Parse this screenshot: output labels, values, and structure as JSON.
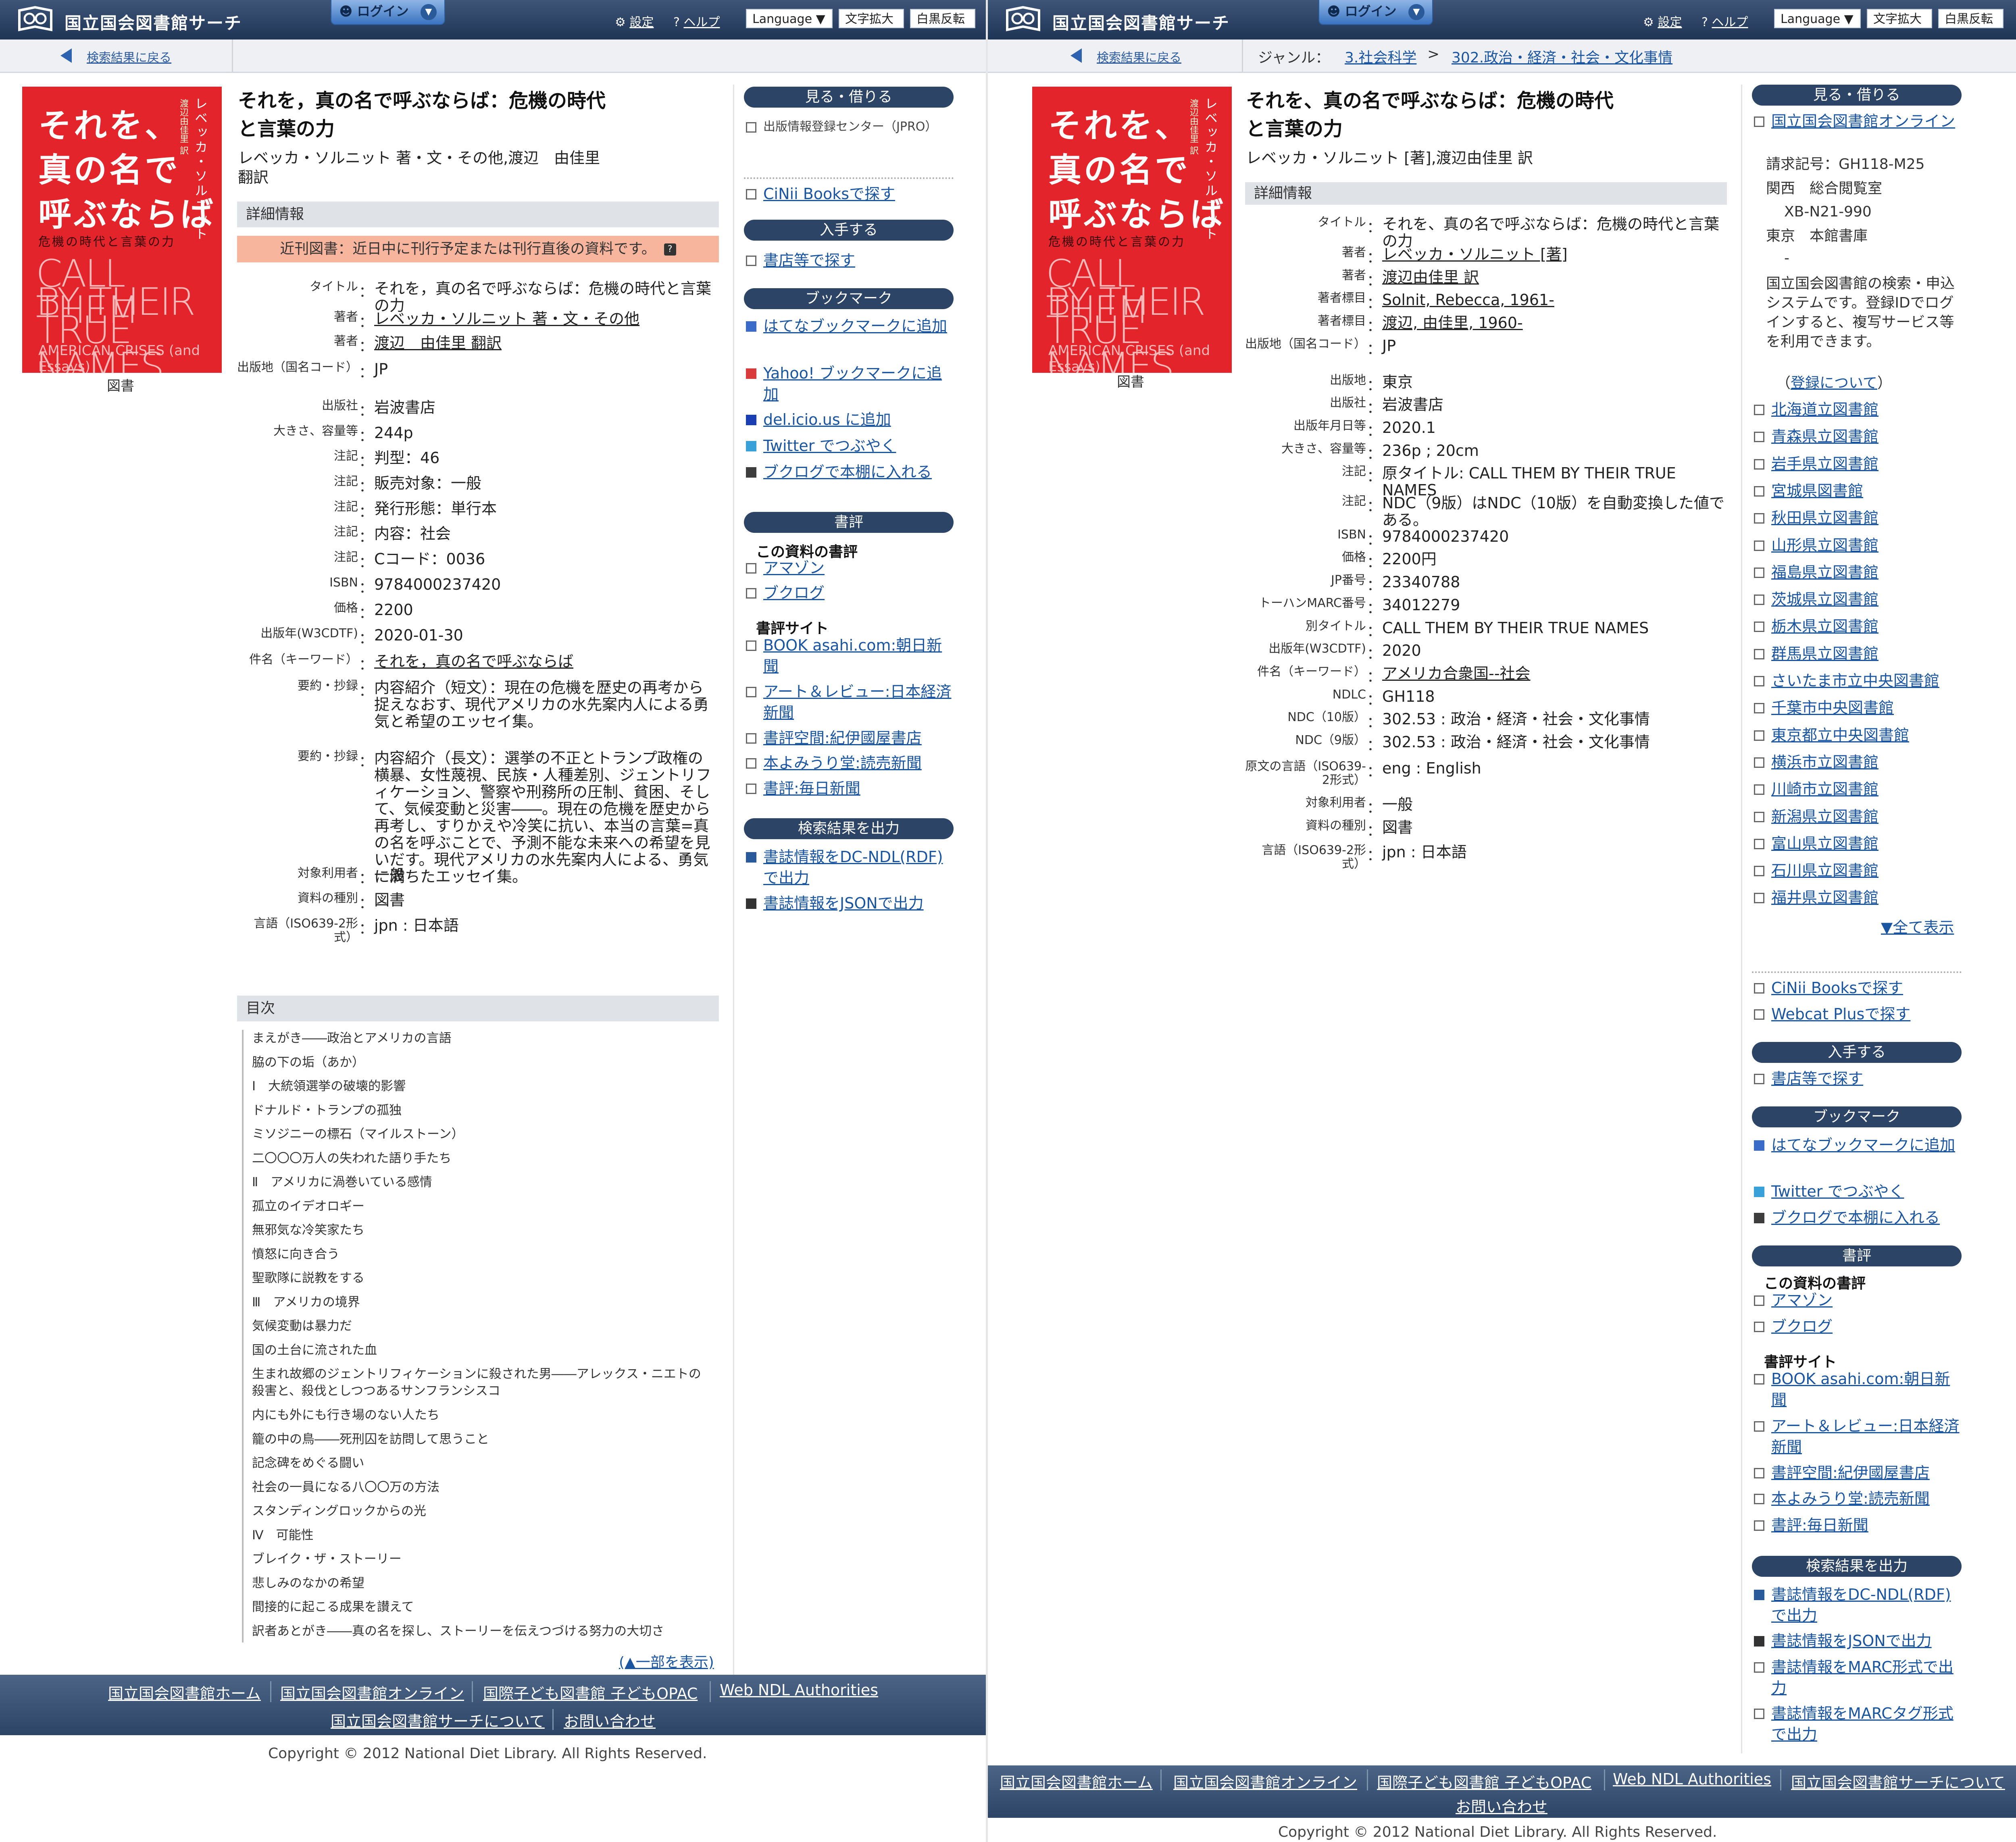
{
  "header": {
    "site_title": "国立国会図書館サーチ",
    "login": "ログイン",
    "settings": "設定",
    "help": "ヘルプ",
    "language": "Language",
    "text_enlarge": "文字拡大",
    "invert": "白黒反転"
  },
  "left": {
    "back": "検索結果に戻る",
    "cover": {
      "jp_line1": "それを、",
      "jp_line2": "真の名で",
      "jp_line3": "呼ぶならば",
      "jp_sub": "危機の時代と言葉の力",
      "author_vertical": "レベッカ・ソルニット",
      "translator_vertical": "渡辺由佳里 訳",
      "en_line1": "CALL THEM",
      "en_line2": "BY THEIR",
      "en_line3": "TRUE NAMES",
      "en_sub": "AMERICAN CRISES (and Essays)",
      "caption": "図書"
    },
    "title_line1": "それを，真の名で呼ぶならば：危機の時代",
    "title_line2": "と言葉の力",
    "author_line1": "レベッカ・ソルニット 著・文・その他,渡辺　由佳里",
    "author_line2": "翻訳",
    "details_heading": "詳細情報",
    "notice": "近刊図書：近日中に刊行予定または刊行直後の資料です。",
    "details": [
      {
        "label": "タイトル",
        "value": "それを，真の名で呼ぶならば：危機の時代と言葉の力"
      },
      {
        "label": "著者",
        "value": "レベッカ・ソルニット 著・文・その他"
      },
      {
        "label": "著者",
        "value": "渡辺　由佳里 翻訳"
      },
      {
        "label": "出版地（国名コード）",
        "value": "JP"
      },
      {
        "label": "出版社",
        "value": "岩波書店"
      },
      {
        "label": "大きさ、容量等",
        "value": "244p"
      },
      {
        "label": "注記",
        "value": "判型：46"
      },
      {
        "label": "注記",
        "value": "販売対象：一般"
      },
      {
        "label": "注記",
        "value": "発行形態：単行本"
      },
      {
        "label": "注記",
        "value": "内容：社会"
      },
      {
        "label": "注記",
        "value": "Cコード：0036"
      },
      {
        "label": "ISBN",
        "value": "9784000237420"
      },
      {
        "label": "価格",
        "value": "2200"
      },
      {
        "label": "出版年(W3CDTF)",
        "value": "2020-01-30"
      },
      {
        "label": "件名（キーワード）",
        "value": "それを，真の名で呼ぶならば"
      },
      {
        "label": "要約・抄録",
        "value": "内容紹介（短文）：現在の危機を歴史の再考から捉えなおす、現代アメリカの水先案内人による勇気と希望のエッセイ集。"
      },
      {
        "label": "要約・抄録",
        "value": "内容紹介（長文）：選挙の不正とトランプ政権の横暴、女性蔑視、民族・人種差別、ジェントリフィケーション、警察や刑務所の圧制、貧困、そして、気候変動と災害――。現在の危機を歴史から再考し、すりかえや冷笑に抗い、本当の言葉=真の名を呼ぶことで、予測不能な未来への希望を見いだす。現代アメリカの水先案内人による、勇気に満ちたエッセイ集。"
      },
      {
        "label": "対象利用者",
        "value": "一般"
      },
      {
        "label": "資料の種別",
        "value": "図書"
      },
      {
        "label": "言語（ISO639-2形式）",
        "value": "jpn : 日本語"
      }
    ],
    "toc_heading": "目次",
    "toc": [
      "まえがき――政治とアメリカの言語",
      "脇の下の垢（あか）",
      "Ⅰ　大統領選挙の破壊的影響",
      "ドナルド・トランプの孤独",
      "ミソジニーの標石（マイルストーン）",
      "二〇〇〇万人の失われた語り手たち",
      "Ⅱ　アメリカに渦巻いている感情",
      "孤立のイデオロギー",
      "無邪気な冷笑家たち",
      "憤怒に向き合う",
      "聖歌隊に説教をする",
      "Ⅲ　アメリカの境界",
      "気候変動は暴力だ",
      "国の土台に流された血",
      "生まれ故郷のジェントリフィケーションに殺された男――アレックス・ニエトの殺害と、殺伐としつつあるサンフランシスコ",
      "内にも外にも行き場のない人たち",
      "籠の中の鳥――死刑囚を訪問して思うこと",
      "記念碑をめぐる闘い",
      "社会の一員になる八〇〇万の方法",
      "スタンディングロックからの光",
      "Ⅳ　可能性",
      "ブレイク・ザ・ストーリー",
      "悲しみのなかの希望",
      "間接的に起こる成果を讃えて",
      "訳者あとがき――真の名を探し、ストーリーを伝えつづける努力の大切さ"
    ],
    "toc_more": "(▲一部を表示)",
    "sidebar": {
      "view": "見る・借りる",
      "view_links": [
        "出版情報登録センター（JPRO）"
      ],
      "cinii": "CiNii Booksで探す",
      "obtain": "入手する",
      "shops": "書店等で探す",
      "bookmark": "ブックマーク",
      "bookmarks": [
        "はてなブックマークに追加",
        "Yahoo! ブックマークに追加",
        "del.icio.us に追加",
        "Twitter でつぶやく",
        "ブクログで本棚に入れる"
      ],
      "review": "書評",
      "review_this": "この資料の書評",
      "review_this_links": [
        "アマゾン",
        "ブクログ"
      ],
      "review_sites": "書評サイト",
      "review_site_links": [
        "BOOK asahi.com:朝日新聞",
        "アート＆レビュー:日本経済新聞",
        "書評空間:紀伊國屋書店",
        "本よみうり堂:読売新聞",
        "書評:毎日新聞"
      ],
      "export": "検索結果を出力",
      "export_links": [
        "書誌情報をDC-NDL(RDF)で出力",
        "書誌情報をJSONで出力"
      ]
    },
    "footer_links": [
      "国立国会図書館ホーム",
      "国立国会図書館オンライン",
      "国際子ども図書館 子どもOPAC",
      "Web NDL Authorities",
      "国立国会図書館サーチについて",
      "お問い合わせ"
    ],
    "copyright": "Copyright © 2012 National Diet Library. All Rights Reserved."
  },
  "right": {
    "back": "検索結果に戻る",
    "genre_label": "ジャンル：",
    "genre1": "3.社会科学",
    "genre_sep": ">",
    "genre2": "302.政治・経済・社会・文化事情",
    "cover_caption": "図書",
    "title_line1": "それを、真の名で呼ぶならば：危機の時代",
    "title_line2": "と言葉の力",
    "author": "レベッカ・ソルニット [著],渡辺由佳里 訳",
    "details_heading": "詳細情報",
    "details": [
      {
        "label": "タイトル",
        "value": "それを、真の名で呼ぶならば：危機の時代と言葉の力"
      },
      {
        "label": "著者",
        "value": "レベッカ・ソルニット [著]"
      },
      {
        "label": "著者",
        "value": "渡辺由佳里 訳"
      },
      {
        "label": "著者標目",
        "value": "Solnit, Rebecca, 1961-"
      },
      {
        "label": "著者標目",
        "value": "渡辺, 由佳里, 1960-"
      },
      {
        "label": "出版地（国名コード）",
        "value": "JP"
      },
      {
        "label": "出版地",
        "value": "東京"
      },
      {
        "label": "出版社",
        "value": "岩波書店"
      },
      {
        "label": "出版年月日等",
        "value": "2020.1"
      },
      {
        "label": "大きさ、容量等",
        "value": "236p ; 20cm"
      },
      {
        "label": "注記",
        "value": "原タイトル: CALL THEM BY THEIR TRUE NAMES"
      },
      {
        "label": "注記",
        "value": "NDC（9版）はNDC（10版）を自動変換した値である。"
      },
      {
        "label": "ISBN",
        "value": "9784000237420"
      },
      {
        "label": "価格",
        "value": "2200円"
      },
      {
        "label": "JP番号",
        "value": "23340788"
      },
      {
        "label": "トーハンMARC番号",
        "value": "34012279"
      },
      {
        "label": "別タイトル",
        "value": "CALL THEM BY THEIR TRUE NAMES"
      },
      {
        "label": "出版年(W3CDTF)",
        "value": "2020"
      },
      {
        "label": "件名（キーワード）",
        "value": "アメリカ合衆国--社会"
      },
      {
        "label": "NDLC",
        "value": "GH118"
      },
      {
        "label": "NDC（10版）",
        "value": "302.53 : 政治・経済・社会・文化事情"
      },
      {
        "label": "NDC（9版）",
        "value": "302.53 : 政治・経済・社会・文化事情"
      },
      {
        "label": "原文の言語（ISO639-2形式）",
        "value": "eng : English"
      },
      {
        "label": "対象利用者",
        "value": "一般"
      },
      {
        "label": "資料の種別",
        "value": "図書"
      },
      {
        "label": "言語（ISO639-2形式）",
        "value": "jpn : 日本語"
      }
    ],
    "sidebar": {
      "view": "見る・借りる",
      "ndl_online": "国立国会図書館オンライン",
      "call_no": "請求記号：GH118-M25",
      "loc1": "関西　総合閲覧室",
      "loc1_code": "XB-N21-990",
      "loc2": "東京　本館書庫",
      "loc2_code": "-",
      "ndl_desc": "国立国会図書館の検索・申込システムです。登録IDでログインすると、複写サービス等を利用できます。",
      "reg_open": "（",
      "reg_link": "登録について",
      "reg_close": "）",
      "libraries": [
        "北海道立図書館",
        "青森県立図書館",
        "岩手県立図書館",
        "宮城県図書館",
        "秋田県立図書館",
        "山形県立図書館",
        "福島県立図書館",
        "茨城県立図書館",
        "栃木県立図書館",
        "群馬県立図書館",
        "さいたま市立中央図書館",
        "千葉市中央図書館",
        "東京都立中央図書館",
        "横浜市立図書館",
        "川崎市立図書館",
        "新潟県立図書館",
        "富山県立図書館",
        "石川県立図書館",
        "福井県立図書館"
      ],
      "show_all": "▼全て表示",
      "cinii": "CiNii Booksで探す",
      "webcat": "Webcat Plusで探す",
      "obtain": "入手する",
      "shops": "書店等で探す",
      "bookmark": "ブックマーク",
      "bookmarks": [
        "はてなブックマークに追加",
        "Twitter でつぶやく",
        "ブクログで本棚に入れる"
      ],
      "review": "書評",
      "review_this": "この資料の書評",
      "review_this_links": [
        "アマゾン",
        "ブクログ"
      ],
      "review_sites": "書評サイト",
      "review_site_links": [
        "BOOK asahi.com:朝日新聞",
        "アート＆レビュー:日本経済新聞",
        "書評空間:紀伊國屋書店",
        "本よみうり堂:読売新聞",
        "書評:毎日新聞"
      ],
      "export": "検索結果を出力",
      "export_links": [
        "書誌情報をDC-NDL(RDF)で出力",
        "書誌情報をJSONで出力",
        "書誌情報をMARC形式で出力",
        "書誌情報をMARCタグ形式で出力"
      ]
    },
    "footer_links": [
      "国立国会図書館ホーム",
      "国立国会図書館オンライン",
      "国際子ども図書館 子どもOPAC",
      "Web NDL Authorities",
      "国立国会図書館サーチについて",
      "お問い合わせ"
    ],
    "copyright": "Copyright © 2012 National Diet Library. All Rights Reserved."
  }
}
